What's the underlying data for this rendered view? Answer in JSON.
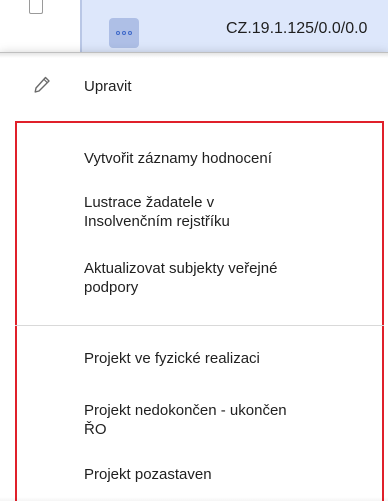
{
  "background_row": {
    "more_icon": "more-horizontal-icon",
    "code": "CZ.19.1.125/0.0/0.0"
  },
  "menu": {
    "edit": {
      "icon": "pencil-icon",
      "label": "Upravit"
    },
    "group1": [
      {
        "label": "Vytvořit záznamy hodnocení"
      },
      {
        "label": "Lustrace žadatele v\nInsolvenčním rejstříku"
      },
      {
        "label": "Aktualizovat subjekty veřejné\npodpory"
      }
    ],
    "group2": [
      {
        "label": "Projekt ve fyzické realizaci"
      },
      {
        "label": "Projekt nedokončen - ukončen\nŘO"
      },
      {
        "label": "Projekt pozastaven"
      }
    ],
    "highlight_color": "#e0202a"
  }
}
